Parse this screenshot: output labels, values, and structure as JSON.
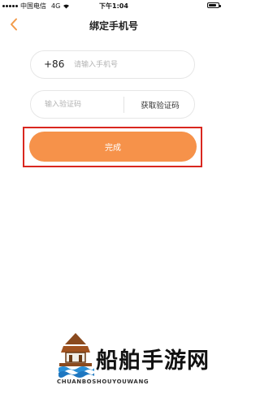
{
  "status_bar": {
    "carrier": "中国电信",
    "network": "4G",
    "time": "下午1:04",
    "battery_level": 0.8
  },
  "nav": {
    "title": "绑定手机号",
    "back_icon": "chevron-left-icon"
  },
  "form": {
    "country_code": "+86",
    "phone_placeholder": "请输入手机号",
    "code_placeholder": "输入验证码",
    "get_code_label": "获取验证码",
    "submit_label": "完成"
  },
  "watermark": {
    "title": "船舶手游网",
    "subtitle": "CHUANBOSHOUYOUWANG"
  },
  "colors": {
    "accent": "#f6924a",
    "highlight_border": "#d9271f",
    "back_icon": "#f29a48"
  }
}
